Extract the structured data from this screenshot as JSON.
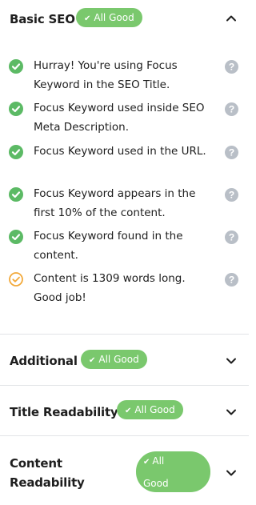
{
  "basic_seo": {
    "title": "Basic SEO",
    "badge": "All Good",
    "expanded": true,
    "items": [
      {
        "status": "good",
        "text": "Hurray! You're using Focus Keyword in the SEO Title."
      },
      {
        "status": "good",
        "text": "Focus Keyword used inside SEO Meta Description."
      },
      {
        "status": "good",
        "text": "Focus Keyword used in the URL."
      },
      {
        "status": "good",
        "text": "Focus Keyword appears in the first 10% of the content."
      },
      {
        "status": "good",
        "text": "Focus Keyword found in the content."
      },
      {
        "status": "ok",
        "text": "Content is 1309 words long. Good job!"
      }
    ]
  },
  "additional": {
    "title": "Additional",
    "badge": "All Good",
    "expanded": false
  },
  "title_readability": {
    "title": "Title Readability",
    "badge": "All Good",
    "expanded": false
  },
  "content_readability": {
    "title_line1": "Content",
    "title_line2": "Readability",
    "badge_line1": "All",
    "badge_line2": "Good",
    "expanded": false
  },
  "colors": {
    "badge_green": "#7ac86d",
    "check_green": "#5cba65",
    "ok_orange": "#f2a93b",
    "help_gray": "#b9bfc7"
  },
  "icons": {
    "check": "check-circle-icon",
    "ok": "check-circle-outline-icon",
    "help": "question-circle-icon",
    "chevron_up": "chevron-up-icon",
    "chevron_down": "chevron-down-icon"
  }
}
